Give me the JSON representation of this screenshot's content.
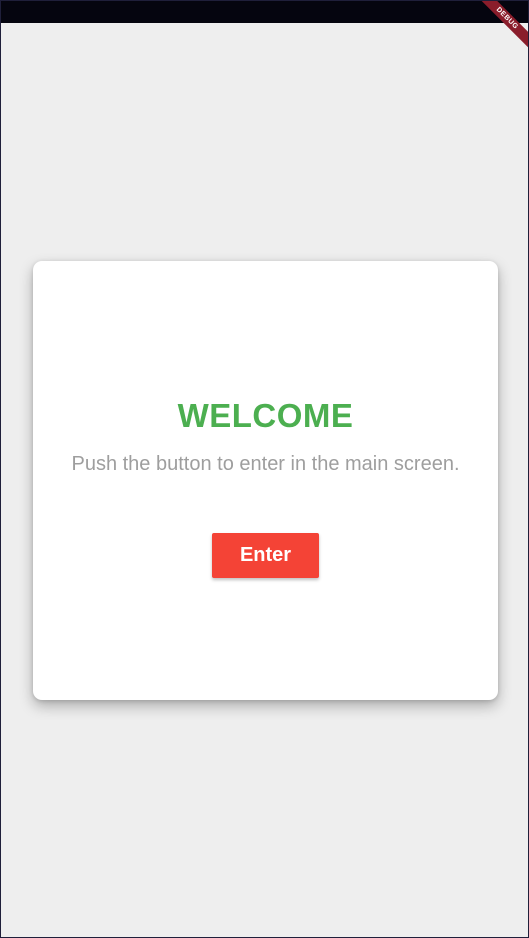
{
  "debug_banner": {
    "label": "DEBUG"
  },
  "card": {
    "title": "WELCOME",
    "subtitle": "Push the button to enter in the main screen.",
    "enter_label": "Enter"
  },
  "colors": {
    "background": "#eeeeee",
    "status_bar": "#05050f",
    "title": "#4caf50",
    "subtitle": "#9e9e9e",
    "button": "#f44336",
    "button_text": "#ffffff",
    "debug_ribbon": "#8a1d2b"
  }
}
